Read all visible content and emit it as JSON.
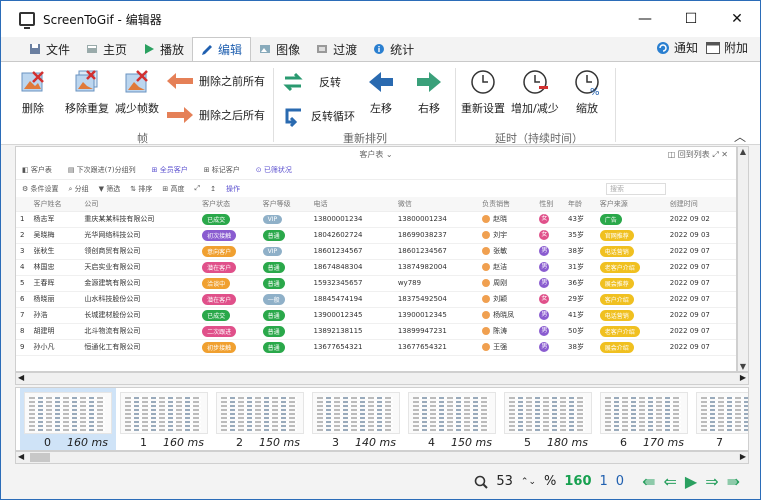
{
  "window": {
    "title": "ScreenToGif - 编辑器",
    "minimize": "—",
    "maximize": "☐",
    "close": "✕"
  },
  "tabs": [
    {
      "label": "文件",
      "icon": "save-icon",
      "active": false
    },
    {
      "label": "主页",
      "icon": "home-icon",
      "active": false
    },
    {
      "label": "播放",
      "icon": "play-icon",
      "active": false
    },
    {
      "label": "编辑",
      "icon": "pencil-icon",
      "active": true
    },
    {
      "label": "图像",
      "icon": "image-icon",
      "active": false
    },
    {
      "label": "过渡",
      "icon": "transition-icon",
      "active": false
    },
    {
      "label": "统计",
      "icon": "info-icon",
      "active": false
    }
  ],
  "tabs_right": {
    "notify": "通知",
    "extra": "附加"
  },
  "ribbon": {
    "frame_group": {
      "label": "帧",
      "delete": "删除",
      "remove_duplicates": "移除重复",
      "reduce_frames": "减少帧数",
      "delete_before": "删除之前所有",
      "delete_after": "删除之后所有"
    },
    "reorder_group": {
      "label": "重新排列",
      "reverse": "反转",
      "yoyo": "反转循环",
      "move_left": "左移",
      "move_right": "右移"
    },
    "delay_group": {
      "label": "延时（持续时间）",
      "override": "重新设置",
      "increase_decrease": "增加/减少",
      "scale": "缩放"
    }
  },
  "preview": {
    "top_title": "客户表 ⌄",
    "top_right": "◫ 回到列表    ⤢   ✕",
    "bar1": [
      "◧ 客户表",
      "▤ 下次跟进(7)分组列",
      "⊞ 全员客户",
      "⊞ 标记客户",
      "⊙ 已筛状况"
    ],
    "bar2": [
      "⚙ 条件设置",
      "⌕ 分组",
      "▼ 筛选",
      "⇅ 排序",
      "⊞ 高度",
      "⤢",
      "↥",
      "操作"
    ],
    "search_placeholder": "搜索",
    "columns": [
      "客户姓名",
      "公司",
      "客户状态",
      "客户等级",
      "电话",
      "微信",
      "负责销售",
      "性别",
      "年龄",
      "客户来源",
      "创建时间"
    ],
    "rows": [
      {
        "no": "1",
        "name": "杨志军",
        "company": "重庆某某科技有限公司",
        "status": "已成交",
        "status_color": "#2aa84a",
        "level": "VIP",
        "level_color": "#8fb0c8",
        "phone": "13800001234",
        "wechat": "13800001234",
        "sales": "赵晓",
        "sex": "女",
        "sex_color": "#e0508a",
        "age": "43岁",
        "source": "广告",
        "source_color": "#2aa84a",
        "created": "2022 09 02"
      },
      {
        "no": "2",
        "name": "吴晓梅",
        "company": "光华网络科技公司",
        "status": "初次接触",
        "status_color": "#8a5cd0",
        "level": "普通",
        "level_color": "#2aa84a",
        "phone": "18042602724",
        "wechat": "18699038237",
        "sales": "刘宇",
        "sex": "女",
        "sex_color": "#e0508a",
        "age": "35岁",
        "source": "官网推荐",
        "source_color": "#f0c020",
        "created": "2022 09 03"
      },
      {
        "no": "3",
        "name": "张秋生",
        "company": "领创商贸有限公司",
        "status": "意向客户",
        "status_color": "#f0a030",
        "level": "VIP",
        "level_color": "#8fb0c8",
        "phone": "18601234567",
        "wechat": "18601234567",
        "sales": "张敏",
        "sex": "男",
        "sex_color": "#8a5cd0",
        "age": "38岁",
        "source": "电话营销",
        "source_color": "#f0c020",
        "created": "2022 09 07"
      },
      {
        "no": "4",
        "name": "林国忠",
        "company": "天启实业有限公司",
        "status": "潜在客户",
        "status_color": "#e0508a",
        "level": "普通",
        "level_color": "#2aa84a",
        "phone": "18674848304",
        "wechat": "13874982004",
        "sales": "赵洁",
        "sex": "男",
        "sex_color": "#8a5cd0",
        "age": "31岁",
        "source": "老客户介绍",
        "source_color": "#f0c020",
        "created": "2022 09 07"
      },
      {
        "no": "5",
        "name": "王春晖",
        "company": "金源建筑有限公司",
        "status": "洽谈中",
        "status_color": "#f0a030",
        "level": "普通",
        "level_color": "#2aa84a",
        "phone": "15932345657",
        "wechat": "wy789",
        "sales": "周刚",
        "sex": "男",
        "sex_color": "#8a5cd0",
        "age": "36岁",
        "source": "展会推荐",
        "source_color": "#f0c020",
        "created": "2022 09 07"
      },
      {
        "no": "6",
        "name": "杨晓丽",
        "company": "山水科技股份公司",
        "status": "潜在客户",
        "status_color": "#e0508a",
        "level": "一般",
        "level_color": "#8fb0c8",
        "phone": "18845474194",
        "wechat": "18375492504",
        "sales": "刘颖",
        "sex": "女",
        "sex_color": "#e0508a",
        "age": "29岁",
        "source": "客户介绍",
        "source_color": "#f0c020",
        "created": "2022 09 07"
      },
      {
        "no": "7",
        "name": "孙浩",
        "company": "长城建材股份公司",
        "status": "已成交",
        "status_color": "#2aa84a",
        "level": "普通",
        "level_color": "#2aa84a",
        "phone": "13900012345",
        "wechat": "13900012345",
        "sales": "杨晓凤",
        "sex": "男",
        "sex_color": "#8a5cd0",
        "age": "41岁",
        "source": "电话营销",
        "source_color": "#f0c020",
        "created": "2022 09 07"
      },
      {
        "no": "8",
        "name": "胡建明",
        "company": "北斗物流有限公司",
        "status": "二次跟进",
        "status_color": "#e0508a",
        "level": "普通",
        "level_color": "#2aa84a",
        "phone": "13892138115",
        "wechat": "13899947231",
        "sales": "陈涛",
        "sex": "男",
        "sex_color": "#8a5cd0",
        "age": "50岁",
        "source": "老客户介绍",
        "source_color": "#f0c020",
        "created": "2022 09 07"
      },
      {
        "no": "9",
        "name": "孙小凡",
        "company": "恒通化工有限公司",
        "status": "初步接触",
        "status_color": "#f0a030",
        "level": "普通",
        "level_color": "#2aa84a",
        "phone": "13677654321",
        "wechat": "13677654321",
        "sales": "王强",
        "sex": "男",
        "sex_color": "#8a5cd0",
        "age": "38岁",
        "source": "展会介绍",
        "source_color": "#f0c020",
        "created": "2022 09 07"
      }
    ]
  },
  "frames": [
    {
      "index": "0",
      "duration": "160 ms",
      "selected": true
    },
    {
      "index": "1",
      "duration": "160 ms",
      "selected": false
    },
    {
      "index": "2",
      "duration": "150 ms",
      "selected": false
    },
    {
      "index": "3",
      "duration": "140 ms",
      "selected": false
    },
    {
      "index": "4",
      "duration": "150 ms",
      "selected": false
    },
    {
      "index": "5",
      "duration": "180 ms",
      "selected": false
    },
    {
      "index": "6",
      "duration": "170 ms",
      "selected": false
    },
    {
      "index": "7",
      "duration": "",
      "selected": false
    }
  ],
  "status": {
    "zoom": "53",
    "percent": "%",
    "total_frames": "160",
    "selected_frames": "1",
    "current_frame": "0"
  },
  "colors": {
    "accent": "#2060b0",
    "green": "#2aa060",
    "red_arrow": "#e05a30"
  }
}
